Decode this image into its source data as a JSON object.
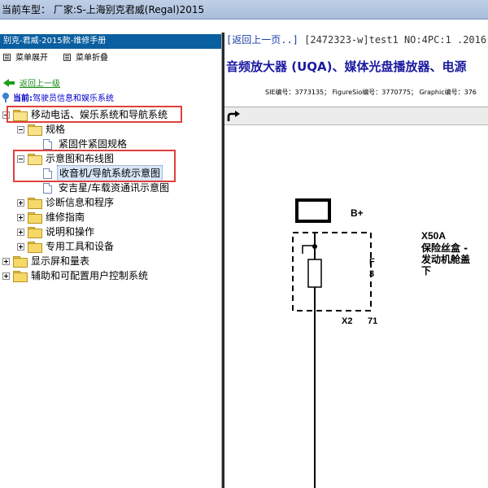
{
  "window": {
    "title": "当前车型： 厂家:S-上海别克君威(Regal)2015"
  },
  "left_panel": {
    "manual_title": "别克-君威-2015款-维修手册",
    "menu": {
      "expand": "菜单展开",
      "collapse": "菜单折叠"
    },
    "back_link": "返回上一级",
    "current_label": "当前:",
    "current_value": "驾驶员信息和娱乐系统",
    "tree": [
      {
        "label": "移动电话、娱乐系统和导航系统"
      },
      {
        "label": "规格"
      },
      {
        "label": "紧固件紧固规格"
      },
      {
        "label": "示意图和布线图"
      },
      {
        "label": "收音机/导航系统示意图"
      },
      {
        "label": "安吉星/车载资通讯示意图"
      },
      {
        "label": "诊断信息和程序"
      },
      {
        "label": "维修指南"
      },
      {
        "label": "说明和操作"
      },
      {
        "label": "专用工具和设备"
      },
      {
        "label": "显示屏和量表"
      },
      {
        "label": "辅助和可配置用户控制系统"
      }
    ]
  },
  "document": {
    "back_link": "[返回上一页..]",
    "doc_info": " [2472323-w]test1 NO:4PC:1 .2016",
    "title": "音频放大器 (UQA)、媒体光盘播放器、电源",
    "meta": "SIE编号：3773135；  FigureSio编号：3770775；  Graphic编号：376"
  },
  "diagram": {
    "supply_label": "B+",
    "fuse_letter": "F",
    "fuse_number": "3",
    "connector": "X2",
    "pin": "71",
    "block_id": "X50A",
    "block_name_line1": "保险丝盒 -",
    "block_name_line2": "发动机舱盖",
    "block_name_line3": "下",
    "colors": {
      "line": "#000000"
    }
  },
  "colors": {
    "highlight_box": "#e0403c",
    "header_bg": "#0a5fa0",
    "title_blue": "#1a1aa0",
    "selection_bg": "#d8e6f7"
  },
  "icons": [
    "folder-icon",
    "document-icon",
    "expand-icon",
    "collapse-icon",
    "back-arrow-icon",
    "location-pin-icon",
    "redo-arrow-icon",
    "menu-icon"
  ]
}
